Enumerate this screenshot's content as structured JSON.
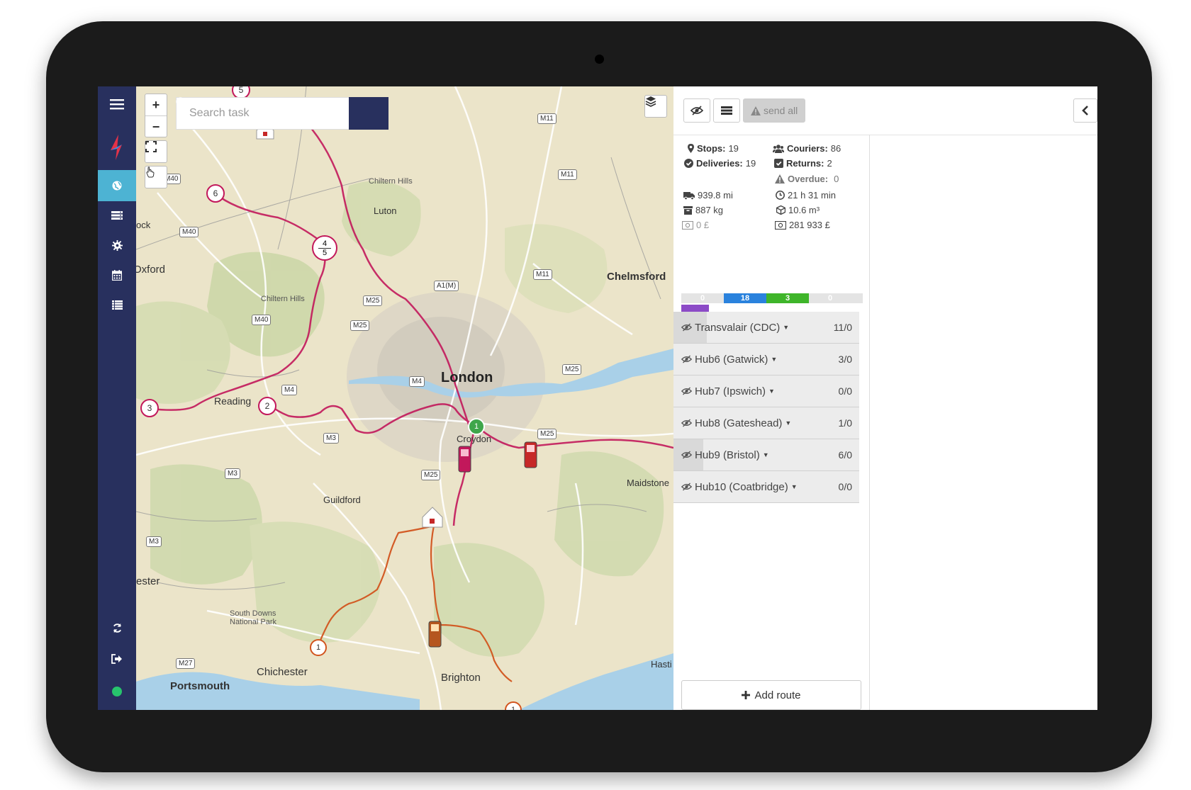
{
  "search": {
    "placeholder": "Search task"
  },
  "zoom": {
    "in_label": "+",
    "out_label": "−"
  },
  "map": {
    "labels": {
      "london": "London",
      "chelmsford": "Chelmsford",
      "oxford": "Oxford",
      "reading": "Reading",
      "luton": "Luton",
      "croydon": "Croydon",
      "guildford": "Guildford",
      "maidstone": "Maidstone",
      "chichester": "Chichester",
      "portsmouth": "Portsmouth",
      "brighton": "Brighton",
      "hastings": "Hasti",
      "chester_partial": "ester",
      "ock_partial": "ock",
      "chiltern_hills_1": "Chiltern Hills",
      "chiltern_hills_2": "Chiltern Hills",
      "south_downs": "South Downs National Park"
    },
    "roads": [
      "M11",
      "M11",
      "M11",
      "M40",
      "M40",
      "M40",
      "A1(M)",
      "M25",
      "M25",
      "M25",
      "M25",
      "M25",
      "M4",
      "M4",
      "M3",
      "M3",
      "M3",
      "M27"
    ],
    "markers": {
      "stop_5_top": "5",
      "stop_6": "6",
      "stop_4": "4",
      "stop_5": "5",
      "stop_3": "3",
      "stop_2": "2",
      "stop_1_green": "1",
      "stop_1_south": "1",
      "stop_1_se": "1"
    }
  },
  "toolbar": {
    "send_all_label": "send all"
  },
  "stats": {
    "stops_label": "Stops:",
    "stops_value": "19",
    "deliveries_label": "Deliveries:",
    "deliveries_value": "19",
    "couriers_label": "Couriers:",
    "couriers_value": "86",
    "returns_label": "Returns:",
    "returns_value": "2",
    "overdue_label": "Overdue:",
    "overdue_value": "0",
    "distance": "939.8 mi",
    "duration": "21 h 31 min",
    "weight": "887 kg",
    "volume": "10.6 m³",
    "cost": "0 £",
    "value": "281 933 £"
  },
  "progress": {
    "segments": [
      {
        "label": "0",
        "color": "#e4e4e4"
      },
      {
        "label": "18",
        "color": "#2a82dd"
      },
      {
        "label": "3",
        "color": "#3fb52a"
      },
      {
        "label": "0",
        "color": "#e4e4e4"
      }
    ],
    "purple_fraction": 0.15
  },
  "hubs": [
    {
      "name": "Transvalair (CDC)",
      "count": "11/0",
      "fill": 0.18
    },
    {
      "name": "Hub6 (Gatwick)",
      "count": "3/0",
      "fill": 0
    },
    {
      "name": "Hub7 (Ipswich)",
      "count": "0/0",
      "fill": 0
    },
    {
      "name": "Hub8 (Gateshead)",
      "count": "1/0",
      "fill": 0
    },
    {
      "name": "Hub9 (Bristol)",
      "count": "6/0",
      "fill": 0.16
    },
    {
      "name": "Hub10 (Coatbridge)",
      "count": "0/0",
      "fill": 0
    }
  ],
  "add_route_label": "Add route",
  "colors": {
    "sidebar": "#28305e",
    "active": "#4db3d3",
    "route_pink": "#c2185b",
    "route_orange": "#d2541e",
    "status": "#27c46d"
  }
}
